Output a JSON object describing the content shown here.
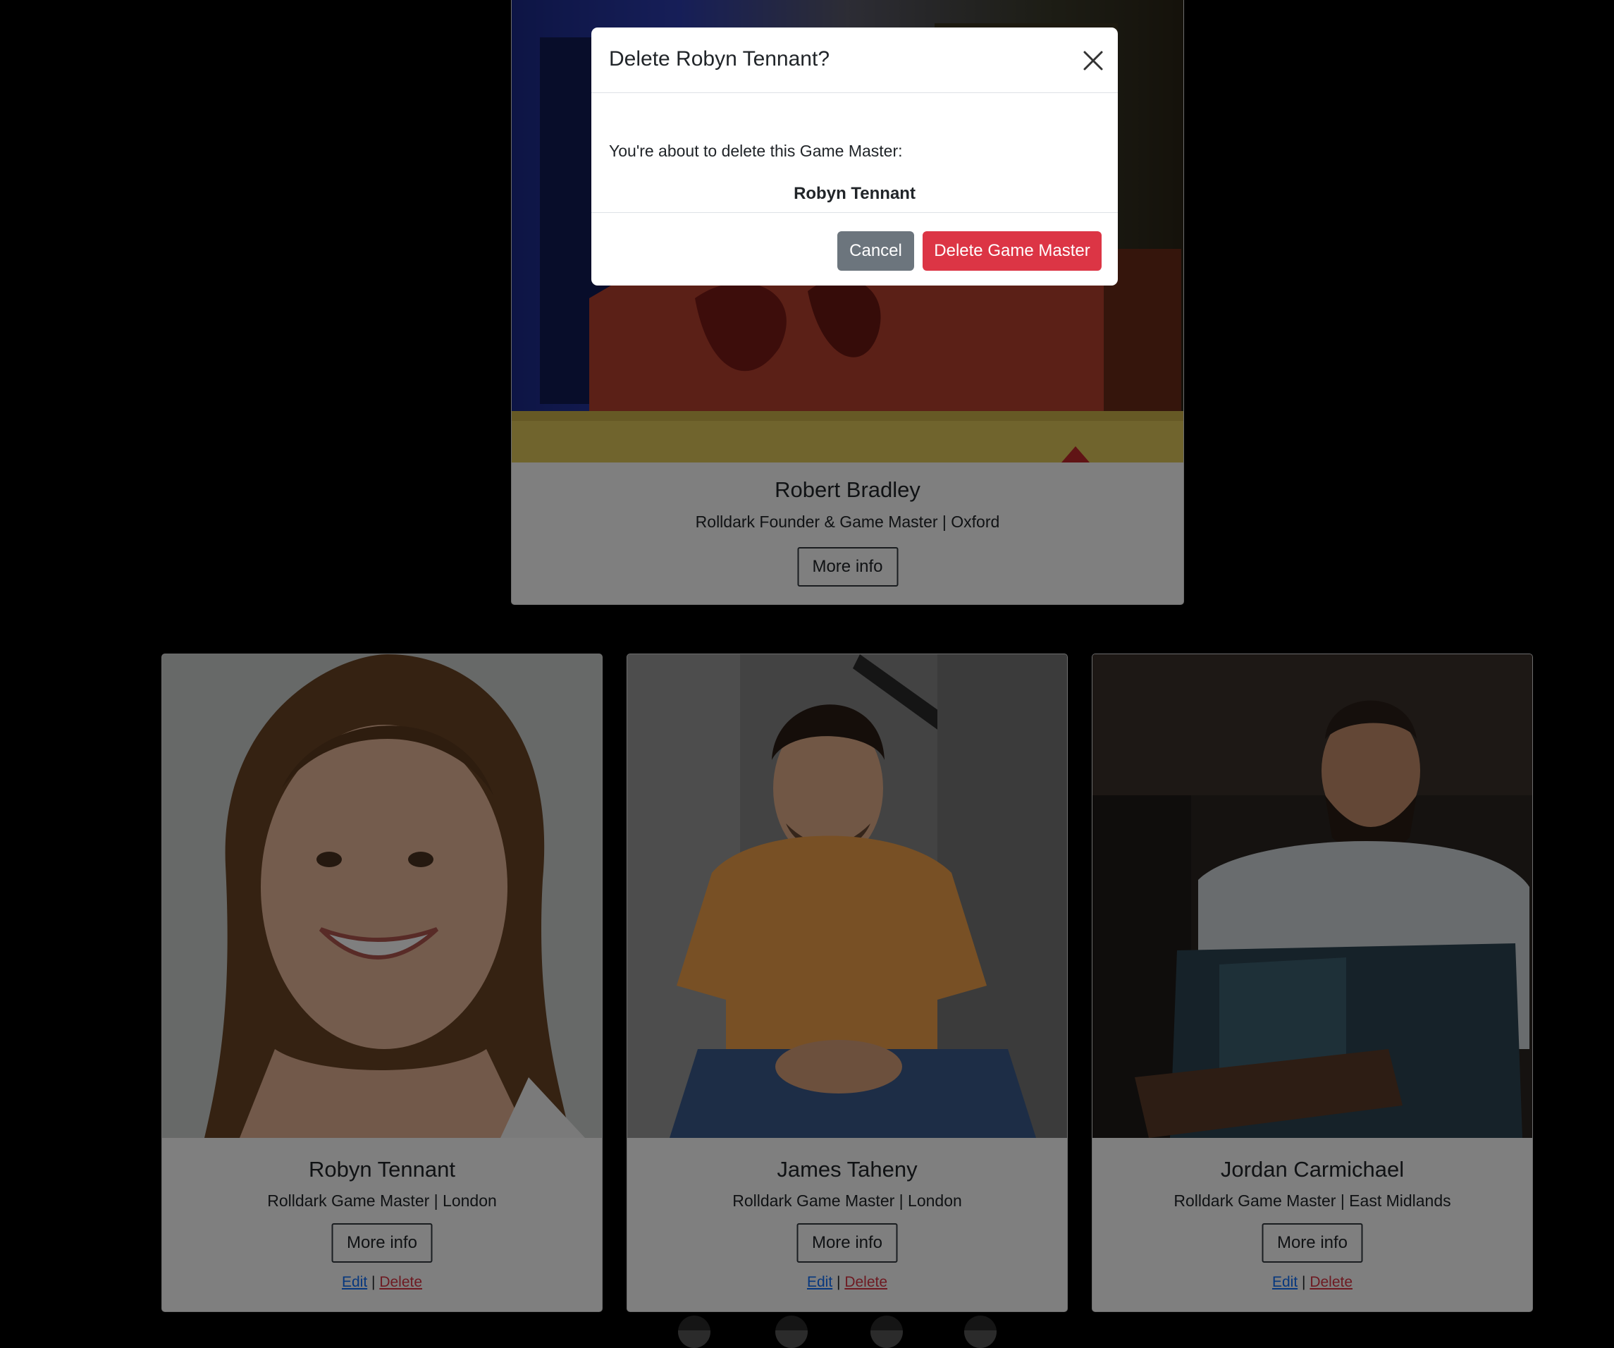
{
  "featured": {
    "name": "Robert Bradley",
    "role": "Rolldark Founder & Game Master | Oxford",
    "more_label": "More info"
  },
  "game_masters": [
    {
      "name": "Robyn Tennant",
      "role": "Rolldark Game Master | London",
      "more_label": "More info",
      "edit_label": "Edit",
      "separator": "|",
      "delete_label": "Delete"
    },
    {
      "name": "James Taheny",
      "role": "Rolldark Game Master | London",
      "more_label": "More info",
      "edit_label": "Edit",
      "separator": "|",
      "delete_label": "Delete"
    },
    {
      "name": "Jordan Carmichael",
      "role": "Rolldark Game Master | East Midlands",
      "more_label": "More info",
      "edit_label": "Edit",
      "separator": "|",
      "delete_label": "Delete"
    }
  ],
  "modal": {
    "title": "Delete Robyn Tennant?",
    "message": "You're about to delete this Game Master:",
    "target_name": "Robyn Tennant",
    "cancel_label": "Cancel",
    "confirm_label": "Delete Game Master"
  },
  "social_icons": [
    "discord-icon",
    "facebook-icon",
    "youtube-icon",
    "instagram-icon"
  ],
  "colors": {
    "danger": "#dc3545",
    "secondary": "#6c757d",
    "link": "#0d6efd",
    "backdrop": "#000000"
  }
}
